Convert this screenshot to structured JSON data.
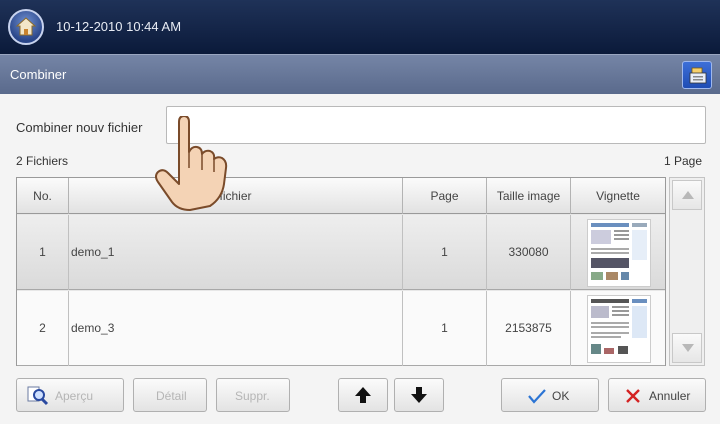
{
  "header": {
    "datetime": "10-12-2010 10:44 AM"
  },
  "titlebar": {
    "title": "Combiner"
  },
  "form": {
    "label": "Combiner nouv fichier",
    "value": ""
  },
  "summary": {
    "files": "2 Fichiers",
    "pages": "1 Page"
  },
  "table": {
    "headers": [
      "No.",
      "fichier",
      "Page",
      "Taille image",
      "Vignette"
    ],
    "rows": [
      {
        "no": "1",
        "name": "demo_1",
        "page": "1",
        "size": "330080"
      },
      {
        "no": "2",
        "name": "demo_3",
        "page": "1",
        "size": "2153875"
      }
    ]
  },
  "buttons": {
    "preview": "Aperçu",
    "detail": "Détail",
    "delete": "Suppr.",
    "ok": "OK",
    "cancel": "Annuler"
  },
  "icons": [
    "home-icon",
    "document-stack-icon",
    "magnifier-icon",
    "arrow-up-icon",
    "arrow-down-icon",
    "checkmark-icon",
    "cross-icon",
    "pointing-hand-icon"
  ],
  "colors": {
    "topbar": "#0b1a3a",
    "titlebar": "#6a7a9a",
    "accent_blue": "#1f4db5",
    "ok_check": "#2b74d4",
    "cancel_x": "#d42222"
  }
}
